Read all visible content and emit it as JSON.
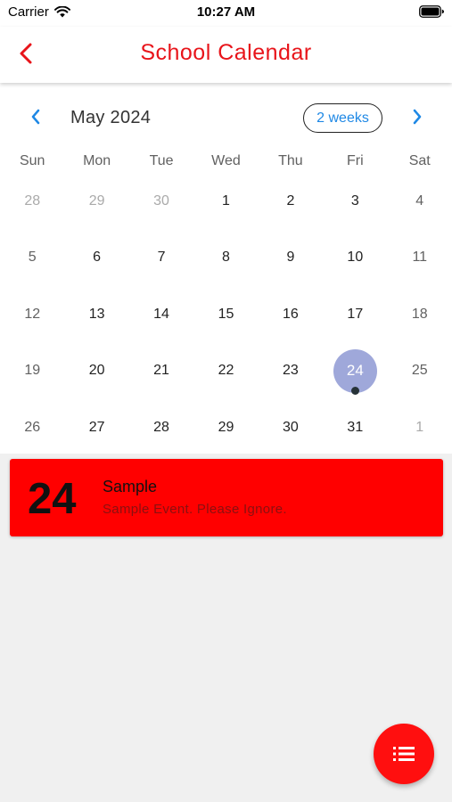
{
  "status_bar": {
    "carrier": "Carrier",
    "time": "10:27 AM"
  },
  "nav": {
    "back_icon": "chevron-left-icon",
    "title": "School Calendar"
  },
  "calendar": {
    "month_label": "May 2024",
    "format_button": "2 weeks",
    "weekdays": [
      "Sun",
      "Mon",
      "Tue",
      "Wed",
      "Thu",
      "Fri",
      "Sat"
    ],
    "weeks": [
      [
        {
          "label": "28",
          "outside": true
        },
        {
          "label": "29",
          "outside": true
        },
        {
          "label": "30",
          "outside": true
        },
        {
          "label": "1"
        },
        {
          "label": "2"
        },
        {
          "label": "3"
        },
        {
          "label": "4"
        }
      ],
      [
        {
          "label": "5"
        },
        {
          "label": "6"
        },
        {
          "label": "7"
        },
        {
          "label": "8"
        },
        {
          "label": "9"
        },
        {
          "label": "10"
        },
        {
          "label": "11"
        }
      ],
      [
        {
          "label": "12"
        },
        {
          "label": "13"
        },
        {
          "label": "14"
        },
        {
          "label": "15"
        },
        {
          "label": "16"
        },
        {
          "label": "17"
        },
        {
          "label": "18"
        }
      ],
      [
        {
          "label": "19"
        },
        {
          "label": "20"
        },
        {
          "label": "21"
        },
        {
          "label": "22"
        },
        {
          "label": "23"
        },
        {
          "label": "24",
          "selected": true,
          "has_event": true
        },
        {
          "label": "25"
        }
      ],
      [
        {
          "label": "26"
        },
        {
          "label": "27"
        },
        {
          "label": "28"
        },
        {
          "label": "29"
        },
        {
          "label": "30"
        },
        {
          "label": "31"
        },
        {
          "label": "1",
          "outside": true
        }
      ]
    ]
  },
  "event": {
    "day": "24",
    "title": "Sample",
    "description": "Sample Event. Please Ignore."
  },
  "fab": {
    "icon": "list-icon"
  },
  "colors": {
    "accent": "#e8141a",
    "event_card": "#ff0000",
    "selected_day": "#9fa8da",
    "link_blue": "#1e88e5",
    "background": "#f0f0f0"
  }
}
